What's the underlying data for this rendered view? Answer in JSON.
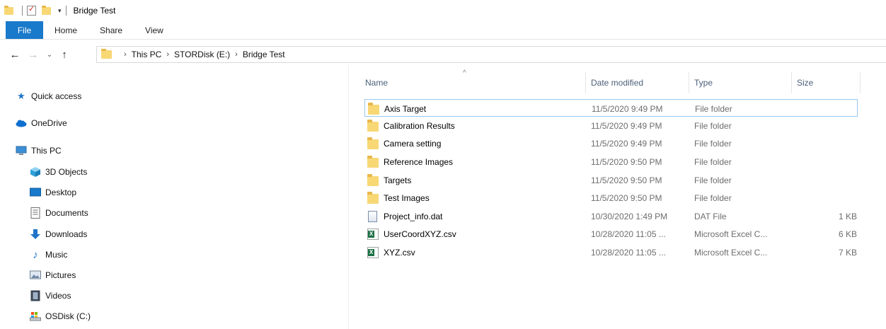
{
  "window": {
    "title": "Bridge Test"
  },
  "ribbon": {
    "tabs": [
      "File",
      "Home",
      "Share",
      "View"
    ]
  },
  "address": {
    "crumbs": [
      "This PC",
      "STORDisk (E:)",
      "Bridge Test"
    ]
  },
  "sidebar": {
    "quick_access": "Quick access",
    "onedrive": "OneDrive",
    "this_pc": "This PC",
    "objects3d": "3D Objects",
    "desktop": "Desktop",
    "documents": "Documents",
    "downloads": "Downloads",
    "music": "Music",
    "pictures": "Pictures",
    "videos": "Videos",
    "osdisk": "OSDisk (C:)"
  },
  "columns": {
    "name": "Name",
    "date": "Date modified",
    "type": "Type",
    "size": "Size"
  },
  "files": [
    {
      "name": "Axis Target",
      "date": "11/5/2020 9:49 PM",
      "type": "File folder",
      "size": "",
      "icon": "folder-icon"
    },
    {
      "name": "Calibration Results",
      "date": "11/5/2020 9:49 PM",
      "type": "File folder",
      "size": "",
      "icon": "folder-icon"
    },
    {
      "name": "Camera setting",
      "date": "11/5/2020 9:49 PM",
      "type": "File folder",
      "size": "",
      "icon": "folder-icon"
    },
    {
      "name": "Reference Images",
      "date": "11/5/2020 9:50 PM",
      "type": "File folder",
      "size": "",
      "icon": "folder-icon"
    },
    {
      "name": "Targets",
      "date": "11/5/2020 9:50 PM",
      "type": "File folder",
      "size": "",
      "icon": "folder-icon"
    },
    {
      "name": "Test Images",
      "date": "11/5/2020 9:50 PM",
      "type": "File folder",
      "size": "",
      "icon": "folder-icon"
    },
    {
      "name": "Project_info.dat",
      "date": "10/30/2020 1:49 PM",
      "type": "DAT File",
      "size": "1 KB",
      "icon": "dat-file-icon"
    },
    {
      "name": "UserCoordXYZ.csv",
      "date": "10/28/2020 11:05 ...",
      "type": "Microsoft Excel C...",
      "size": "6 KB",
      "icon": "excel-file-icon"
    },
    {
      "name": "XYZ.csv",
      "date": "10/28/2020 11:05 ...",
      "type": "Microsoft Excel C...",
      "size": "7 KB",
      "icon": "excel-file-icon"
    }
  ],
  "colors": {
    "file_tab": "#1979ca",
    "selection_border": "#99c9ef",
    "header_text": "#4c607a",
    "folder": "#f8d775"
  }
}
